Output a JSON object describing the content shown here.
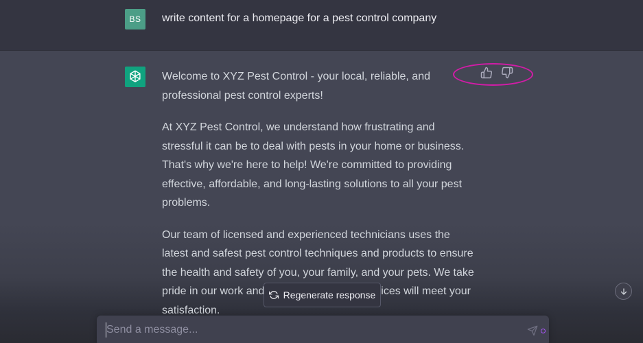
{
  "user_message": {
    "avatar_initials": "BS",
    "avatar_color": "#4c9e87",
    "text": "write content for a homepage for a pest control company"
  },
  "assistant_message": {
    "avatar_icon": "openai-logo-icon",
    "avatar_color": "#10a37f",
    "paragraphs": [
      "Welcome to XYZ Pest Control - your local, reliable, and professional pest control experts!",
      "At XYZ Pest Control, we understand how frustrating and stressful it can be to deal with pests in your home or business. That's why we're here to help! We're committed to providing effective, affordable, and long-lasting solutions to all your pest problems.",
      "Our team of licensed and experienced technicians uses the latest and safest pest control techniques and products to ensure the health and safety of you, your family, and your pets. We take pride in our work and guarantee that our services will meet your satisfaction."
    ],
    "feedback": {
      "thumbs_up_icon": "thumbs-up-icon",
      "thumbs_down_icon": "thumbs-down-icon",
      "highlight_color": "#d21ca7"
    }
  },
  "actions": {
    "regenerate_label": "Regenerate response",
    "regenerate_icon": "refresh-icon",
    "scroll_down_icon": "arrow-down-icon"
  },
  "composer": {
    "placeholder": "Send a message...",
    "value": "",
    "send_icon": "send-icon"
  },
  "theme": {
    "user_row_bg": "#343541",
    "assistant_row_bg": "#444654",
    "text_color": "#d1d5db"
  }
}
